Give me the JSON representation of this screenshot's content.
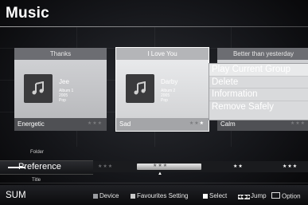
{
  "page": {
    "title": "Music"
  },
  "cards": [
    {
      "song": "Thanks",
      "artist": "Jee",
      "album": "Album 1",
      "year": "2005",
      "genre": "Pop",
      "mood": "Energetic",
      "stars": "★★★",
      "rating": 0,
      "focused": false
    },
    {
      "song": "I Love You",
      "artist": "Darby",
      "album": "Album 2",
      "year": "2005",
      "genre": "Pop",
      "mood": "Sad",
      "stars": "★★★",
      "rating": 1,
      "focused": true
    },
    {
      "song": "Better than yesterday",
      "mood": "Calm",
      "stars": "★★★",
      "rating": 0,
      "focused": false
    }
  ],
  "context_menu": {
    "items": [
      {
        "label": "Play Current Group"
      },
      {
        "label": "Delete"
      },
      {
        "label": "Information"
      },
      {
        "label": "Remove Safely"
      }
    ],
    "selected_index": 0
  },
  "sort": {
    "prev": "Folder",
    "current": "Preference",
    "next": "Title",
    "levels": [
      "★★★",
      "★★★",
      "★★",
      "★★★"
    ]
  },
  "status_bar": {
    "device_label": "SUM",
    "hints": [
      {
        "label": "Device",
        "color": "#9a9ca0"
      },
      {
        "label": "Favourites Setting",
        "color": "#c9c9c9"
      },
      {
        "label": "Select",
        "color": "#ffffff"
      },
      {
        "label": "Jump"
      },
      {
        "label": "Option"
      }
    ]
  }
}
